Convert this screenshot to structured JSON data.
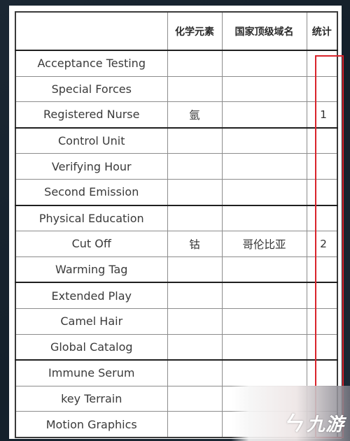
{
  "table": {
    "headers": [
      "",
      "化学元素",
      "国家顶级域名",
      "统计"
    ],
    "rows": [
      {
        "label": "Acceptance Testing",
        "element": "",
        "tld": "",
        "count": ""
      },
      {
        "label": "Special Forces",
        "element": "",
        "tld": "",
        "count": ""
      },
      {
        "label": "Registered Nurse",
        "element": "氩",
        "tld": "",
        "count": "1"
      },
      {
        "label": "Control Unit",
        "element": "",
        "tld": "",
        "count": ""
      },
      {
        "label": "Verifying Hour",
        "element": "",
        "tld": "",
        "count": ""
      },
      {
        "label": "Second Emission",
        "element": "",
        "tld": "",
        "count": ""
      },
      {
        "label": "Physical Education",
        "element": "",
        "tld": "",
        "count": ""
      },
      {
        "label": "Cut Off",
        "element": "钴",
        "tld": "哥伦比亚",
        "count": "2"
      },
      {
        "label": "Warming Tag",
        "element": "",
        "tld": "",
        "count": ""
      },
      {
        "label": "Extended Play",
        "element": "",
        "tld": "",
        "count": ""
      },
      {
        "label": "Camel Hair",
        "element": "",
        "tld": "",
        "count": ""
      },
      {
        "label": "Global Catalog",
        "element": "",
        "tld": "",
        "count": ""
      },
      {
        "label": "Immune Serum",
        "element": "",
        "tld": "",
        "count": ""
      },
      {
        "label": "key Terrain",
        "element": "",
        "tld": "",
        "count": ""
      },
      {
        "label": "Motion Graphics",
        "element": "",
        "tld": "",
        "count": ""
      }
    ]
  },
  "highlight": {
    "column": "统计",
    "color": "#d9232b"
  },
  "watermark": {
    "icon": "jiuyou-logo-icon",
    "text": "九游",
    "mark": "ㄣ"
  }
}
